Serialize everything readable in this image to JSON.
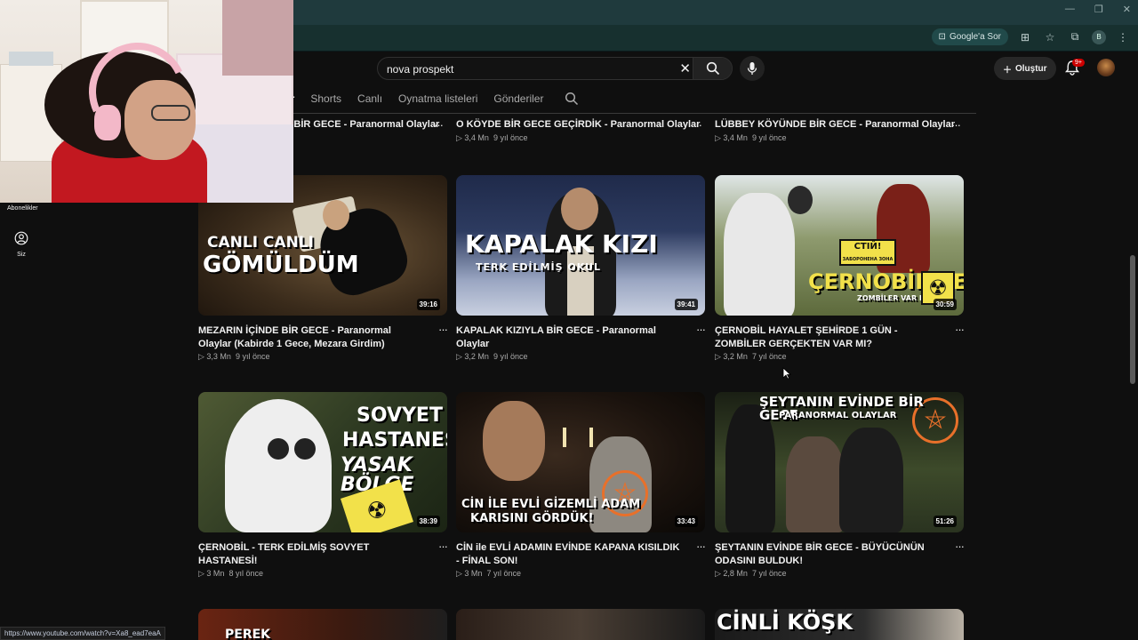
{
  "browser": {
    "google_sor": "Google'a Sor",
    "profile_initial": "B",
    "status_url": "https://www.youtube.com/watch?v=Xa8_ead7eaA"
  },
  "header": {
    "search_value": "nova prospekt",
    "create_label": "Oluştur",
    "notif_badge": "9+"
  },
  "tabs": {
    "partial": "ar",
    "items": [
      "Shorts",
      "Canlı",
      "Oynatma listeleri",
      "Gönderiler"
    ]
  },
  "sidebar": {
    "subs_label": "Abonelikler",
    "you_label": "Siz"
  },
  "top_row": [
    {
      "title": "E BİR GECE - Paranormal Olaylar",
      "views": "",
      "age": ""
    },
    {
      "title": "O KÖYDE BİR GECE GEÇİRDİK - Paranormal Olaylar",
      "views": "3,4 Mn",
      "age": "9 yıl önce"
    },
    {
      "title": "LÜBBEY KÖYÜNDE BİR GECE - Paranormal Olaylar",
      "views": "3,4 Mn",
      "age": "9 yıl önce"
    }
  ],
  "videos": [
    {
      "title": "MEZARIN İÇİNDE BİR GECE - Paranormal Olaylar (Kabirde 1 Gece, Mezara Girdim)",
      "views": "3,3 Mn",
      "age": "9 yıl önce",
      "duration": "39:16",
      "thumb_text": [
        "CANLI CANLI",
        "GÖMÜLDÜM"
      ]
    },
    {
      "title": "KAPALAK KIZIYLA BİR GECE - Paranormal Olaylar",
      "views": "3,2 Mn",
      "age": "9 yıl önce",
      "duration": "39:41",
      "thumb_text": [
        "KAPALAK KIZI",
        "TERK EDİLMİŞ OKUL"
      ]
    },
    {
      "title": "ÇERNOBİL HAYALET ŞEHİRDE 1 GÜN - ZOMBİLER GERÇEKTEN VAR MI?",
      "views": "3,2 Mn",
      "age": "7 yıl önce",
      "duration": "30:59",
      "thumb_text": [
        "ÇERNOBİL'DE",
        "ZOMBİLER VAR MI?",
        "СТІЙ!",
        "ЗАБОРОНЕНА ЗОНА"
      ]
    },
    {
      "title": "ÇERNOBİL - TERK EDİLMİŞ SOVYET HASTANESİ!",
      "views": "3 Mn",
      "age": "8 yıl önce",
      "duration": "38:39",
      "thumb_text": [
        "SOVYET",
        "HASTANESİ",
        "YASAK BÖLGE"
      ]
    },
    {
      "title": "CİN ile EVLİ ADAMIN EVİNDE KAPANA KISILDIK - FİNAL SON!",
      "views": "3 Mn",
      "age": "7 yıl önce",
      "duration": "33:43",
      "thumb_text": [
        "CİN İLE EVLİ GİZEMLİ ADAM",
        "KARISINI GÖRDÜK!"
      ]
    },
    {
      "title": "ŞEYTANIN EVİNDE BİR GECE - BÜYÜCÜNÜN ODASINI BULDUK!",
      "views": "2,8 Mn",
      "age": "7 yıl önce",
      "duration": "51:26",
      "thumb_text": [
        "ŞEYTANIN EVİNDE BİR GECE",
        "PARANORMAL OLAYLAR"
      ]
    }
  ],
  "bottom_row": [
    {
      "thumb_text": "PEREK"
    },
    {
      "thumb_text": ""
    },
    {
      "thumb_text": "CİNLİ KÖŞK"
    }
  ]
}
